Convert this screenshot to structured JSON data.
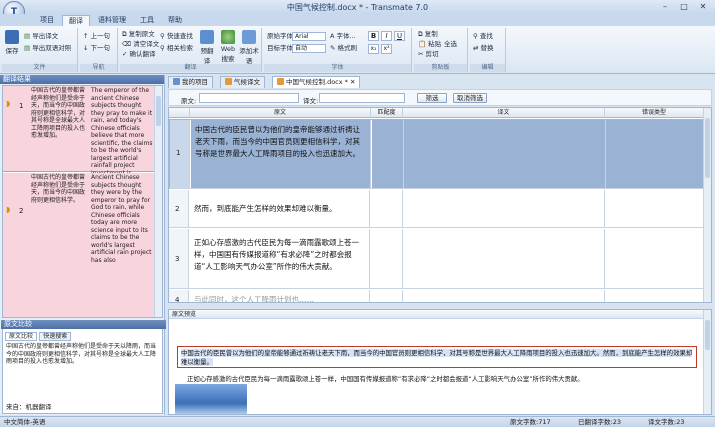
{
  "titlebar": {
    "title": "中国气候控制.docx * - Transmate 7.0",
    "min": "–",
    "max": "□",
    "close": "✕"
  },
  "app_menu": {
    "label": "T"
  },
  "tabs": [
    "项目",
    "翻译",
    "语料管理",
    "工具",
    "帮助"
  ],
  "active_tab": "翻译",
  "ribbon": {
    "file": {
      "save": "保存",
      "export_translation": "导出译文",
      "export_bilingual": "导出双语对照",
      "label": "文件"
    },
    "nav": {
      "prev": "上一句",
      "next": "下一句",
      "label": "导航"
    },
    "translate": {
      "copy_source": "复制原文",
      "clear_target": "清空译文",
      "confirm": "确认翻译",
      "fast_search": "快速查找",
      "tm_search": "相关检索",
      "pretranslate": "预翻译",
      "web_search": "Web搜索",
      "add_term": "添加术语",
      "label": "翻译"
    },
    "font": {
      "source_font_label": "原始字体",
      "source_font": "Arial",
      "target_font_label": "目标字体",
      "target_size": "自动",
      "font_btn": "字体...",
      "format_btn": "格式刷",
      "bold": "B",
      "italic": "I",
      "underline": "U",
      "sub": "x₂",
      "sup": "x²",
      "label": "字体"
    },
    "clipboard": {
      "copy": "复制",
      "paste": "粘贴",
      "select_all": "全选",
      "cut": "剪切",
      "label": "剪贴板"
    },
    "edit": {
      "find": "查找",
      "replace": "替换",
      "label": "编辑"
    }
  },
  "left_pane": {
    "header": "翻译结果",
    "rows": [
      {
        "num": "1",
        "source": "中国古代的皇帝都曾经声称他们是受命于天，而当今的中国政府则更相信科学，对其号称是全球最大人工降雨项目的投入也愈发增加。",
        "target": "The emperor of the ancient Chinese subjects thought they pray to make it rain, and today's Chinese officials believe that more scientific, the claims to be the world's largest artificial rainfall project investment is increasing rapidly."
      },
      {
        "num": "2",
        "source": "中国古代的皇帝都曾经声称他们是受命于天，而当今的中国政府则更相信科学。",
        "target": "Ancient Chinese subjects thought they were by the emperor to pray for God to rain, while Chinese officials today are more science input to its claims to be the world's largest artificial rain project has also"
      }
    ],
    "sub_header": "原文比较",
    "sub_tabs": [
      "原文比较",
      "快速搜索"
    ],
    "sub_text": "中国古代的皇帝都曾经声称他们是受命于天以降雨，而当今的中国政府则更相信科学，对其号称是全球最大人工降雨项目的投入也愈发增加。",
    "sub_footer": "来自：机器翻译"
  },
  "doc_tabs": [
    "我的项目",
    "气候译文",
    "中国气候控制.docx *"
  ],
  "filter": {
    "source_label": "原文:",
    "target_label": "译文:",
    "filter_btn": "筛选",
    "cancel_btn": "取消筛选"
  },
  "grid": {
    "columns": [
      "原文",
      "匹配度",
      "译文",
      "错误类型"
    ],
    "rows": [
      {
        "num": "1",
        "source": "中国古代的臣民曾以为他们的皇帝能够通过祈祷让老天下雨，而当今的中国官员则更相信科学，对其号称是世界最大人工降雨项目的投入也迅速加大。",
        "selected": true
      },
      {
        "num": "2",
        "source": "然而，到底能产生怎样的效果却难以衡量。",
        "selected": false
      },
      {
        "num": "3",
        "source": "正如心存感激的古代臣民为每一滴雨露歌颂上苍一样，中国国有传媒报道称“有求必降”之时都会报道“人工影响天气办公室”所作的伟大贡献。",
        "selected": false
      },
      {
        "num": "4",
        "source": "与此同时，这个人工降雨计划也……",
        "selected": false
      }
    ]
  },
  "preview": {
    "header": "原文预览",
    "para1": "中国古代的臣民曾以为他们的皇帝能够通过祈祷让老天下雨，而当今的中国官员则更相信科学，对其号称是世界最大人工降雨项目的投入也迅速加大。然而，到底能产生怎样的效果却难以衡量。",
    "para2": "正如心存感激的古代臣民为每一滴雨露歌颂上苍一样，中国国有传媒报道称“有求必降”之时都会报道“人工影响天气办公室”所作的伟大贡献。"
  },
  "status": {
    "lang": "中文简体-英语",
    "source_chars": "原文字数:717",
    "translated": "已翻译字数:23",
    "target_chars": "译文字数:23"
  }
}
